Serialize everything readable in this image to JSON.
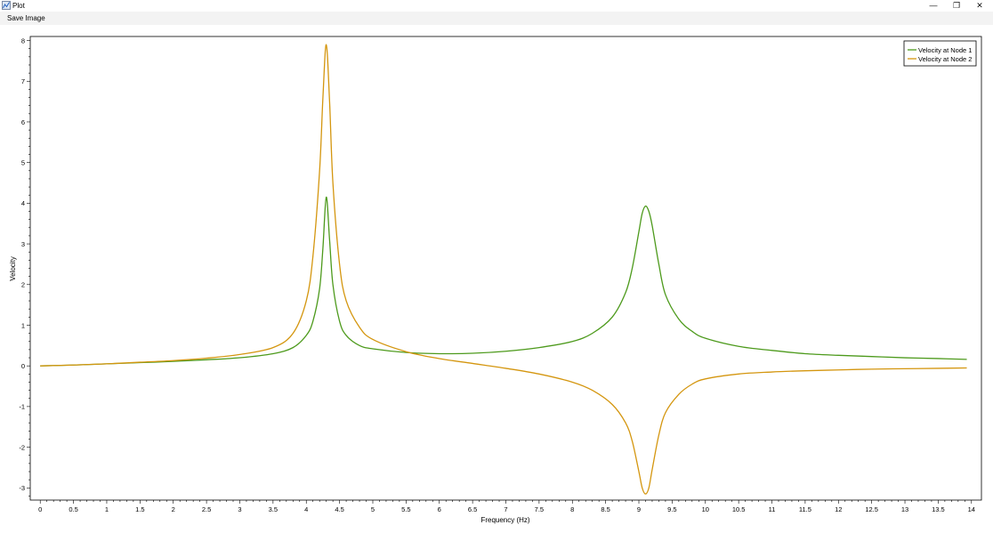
{
  "window": {
    "title": "Plot",
    "app_icon": "plot-window-icon",
    "minimize_glyph": "—",
    "restore_glyph": "❐",
    "close_glyph": "✕"
  },
  "menu": {
    "items": [
      {
        "label": "Save Image"
      }
    ]
  },
  "chart_data": {
    "type": "line",
    "title": "",
    "xlabel": "Frequency (Hz)",
    "ylabel": "Velocity",
    "xlim": [
      -0.15,
      14.15
    ],
    "ylim": [
      -3.3,
      8.1
    ],
    "x_ticks": [
      0,
      0.5,
      1,
      1.5,
      2,
      2.5,
      3,
      3.5,
      4,
      4.5,
      5,
      5.5,
      6,
      6.5,
      7,
      7.5,
      8,
      8.5,
      9,
      9.5,
      10,
      10.5,
      11,
      11.5,
      12,
      12.5,
      13,
      13.5,
      14
    ],
    "x_tick_labels": [
      "0",
      "0.5",
      "1",
      "1.5",
      "2",
      "2.5",
      "3",
      "3.5",
      "4",
      "4.5",
      "5",
      "5.5",
      "6",
      "6.5",
      "7",
      "7.5",
      "8",
      "8.5",
      "9",
      "9.5",
      "10",
      "10.5",
      "11",
      "11.5",
      "12",
      "12.5",
      "13",
      "13.5",
      "14"
    ],
    "y_ticks": [
      -3,
      -2,
      -1,
      0,
      1,
      2,
      3,
      4,
      5,
      6,
      7,
      8
    ],
    "y_tick_labels": [
      "-3",
      "-2",
      "-1",
      "0",
      "1",
      "2",
      "3",
      "4",
      "5",
      "6",
      "7",
      "8"
    ],
    "grid": false,
    "legend": "top-right",
    "series": [
      {
        "name": "Velocity at Node 1",
        "color": "#4d9a1c",
        "x": [
          0,
          0.5,
          1,
          1.5,
          2,
          2.5,
          3,
          3.5,
          3.8,
          4.0,
          4.1,
          4.2,
          4.25,
          4.3,
          4.35,
          4.4,
          4.5,
          4.6,
          4.8,
          5.0,
          5.5,
          6.0,
          6.5,
          7.0,
          7.5,
          8.0,
          8.3,
          8.6,
          8.8,
          8.9,
          9.0,
          9.05,
          9.1,
          9.15,
          9.2,
          9.3,
          9.4,
          9.6,
          9.8,
          10.0,
          10.5,
          11.0,
          11.5,
          12.0,
          12.5,
          13.0,
          13.5,
          13.93
        ],
        "y": [
          0,
          0.02,
          0.05,
          0.08,
          0.11,
          0.15,
          0.2,
          0.3,
          0.45,
          0.75,
          1.1,
          1.9,
          2.9,
          4.15,
          3.1,
          2.0,
          1.1,
          0.75,
          0.5,
          0.42,
          0.33,
          0.3,
          0.31,
          0.36,
          0.45,
          0.6,
          0.8,
          1.2,
          1.8,
          2.4,
          3.3,
          3.75,
          3.93,
          3.8,
          3.45,
          2.5,
          1.75,
          1.15,
          0.85,
          0.68,
          0.48,
          0.38,
          0.3,
          0.26,
          0.23,
          0.2,
          0.18,
          0.16
        ]
      },
      {
        "name": "Velocity at Node 2",
        "color": "#d4960f",
        "x": [
          0,
          0.5,
          1,
          1.5,
          2,
          2.5,
          3,
          3.5,
          3.8,
          4.0,
          4.1,
          4.2,
          4.25,
          4.3,
          4.35,
          4.4,
          4.5,
          4.6,
          4.8,
          5.0,
          5.5,
          6.0,
          6.5,
          7.0,
          7.5,
          8.0,
          8.3,
          8.6,
          8.8,
          8.9,
          9.0,
          9.05,
          9.1,
          9.15,
          9.2,
          9.3,
          9.4,
          9.6,
          9.8,
          10.0,
          10.5,
          11.0,
          11.5,
          12.0,
          12.5,
          13.0,
          13.5,
          13.93
        ],
        "y": [
          0,
          0.02,
          0.05,
          0.09,
          0.13,
          0.19,
          0.28,
          0.45,
          0.8,
          1.6,
          2.7,
          4.8,
          6.6,
          7.9,
          6.5,
          4.5,
          2.5,
          1.6,
          0.95,
          0.65,
          0.35,
          0.18,
          0.06,
          -0.06,
          -0.2,
          -0.4,
          -0.6,
          -0.95,
          -1.4,
          -1.85,
          -2.6,
          -3.0,
          -3.15,
          -3.0,
          -2.55,
          -1.7,
          -1.15,
          -0.7,
          -0.45,
          -0.32,
          -0.2,
          -0.15,
          -0.12,
          -0.1,
          -0.08,
          -0.07,
          -0.06,
          -0.05
        ]
      }
    ]
  }
}
